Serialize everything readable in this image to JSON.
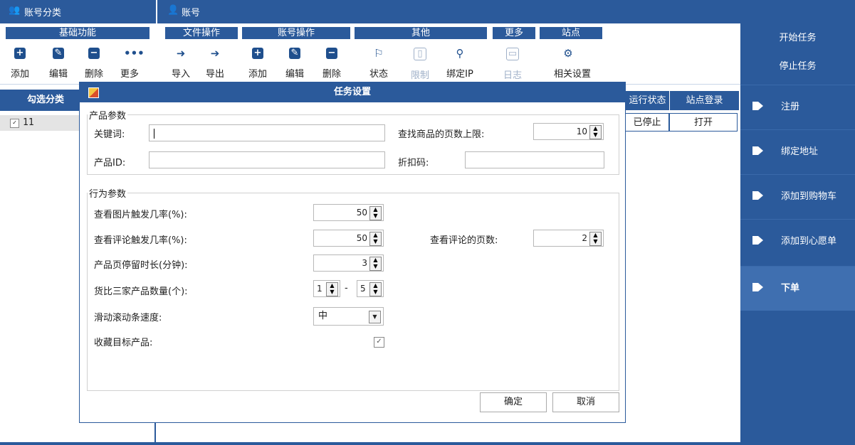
{
  "topbar": {
    "left_title": "账号分类",
    "right_title": "账号"
  },
  "ribbon": {
    "groups": [
      {
        "title": "基础功能",
        "buttons": [
          "添加",
          "编辑",
          "删除",
          "更多"
        ]
      },
      {
        "title": "文件操作",
        "buttons": [
          "导入",
          "导出"
        ]
      },
      {
        "title": "账号操作",
        "buttons": [
          "添加",
          "编辑",
          "删除"
        ]
      },
      {
        "title": "其他",
        "buttons": [
          "状态",
          "限制",
          "绑定IP"
        ]
      },
      {
        "title": "更多",
        "buttons": [
          "日志"
        ]
      },
      {
        "title": "站点",
        "buttons": [
          "相关设置"
        ]
      }
    ]
  },
  "left_panel": {
    "header": "勾选分类",
    "rows": [
      {
        "checked": true,
        "label": "11"
      }
    ]
  },
  "table": {
    "headers": [
      "运行状态",
      "站点登录"
    ],
    "row": [
      "已停止",
      "打开"
    ]
  },
  "right_bar": {
    "start_task": "开始任务",
    "stop_task": "停止任务",
    "items": [
      "注册",
      "绑定地址",
      "添加到购物车",
      "添加到心愿单",
      "下单"
    ],
    "active_item": "下单"
  },
  "dialog": {
    "title": "任务设置",
    "product_group": "产品参数",
    "keyword_label": "关键词:",
    "keyword_value": "",
    "max_pages_label": "查找商品的页数上限:",
    "max_pages_value": "10",
    "product_id_label": "产品ID:",
    "product_id_value": "",
    "discount_label": "折扣码:",
    "discount_value": "",
    "behavior_group": "行为参数",
    "image_prob_label": "查看图片触发几率(%):",
    "image_prob_value": "50",
    "review_prob_label": "查看评论触发几率(%):",
    "review_prob_value": "50",
    "review_pages_label": "查看评论的页数:",
    "review_pages_value": "2",
    "stay_label": "产品页停留时长(分钟):",
    "stay_value": "3",
    "compare_label": "货比三家产品数量(个):",
    "compare_min": "1",
    "compare_sep": "-",
    "compare_max": "5",
    "scroll_label": "滑动滚动条速度:",
    "scroll_value": "中",
    "favorite_label": "收藏目标产品:",
    "favorite_checked": true,
    "ok": "确定",
    "cancel": "取消"
  }
}
